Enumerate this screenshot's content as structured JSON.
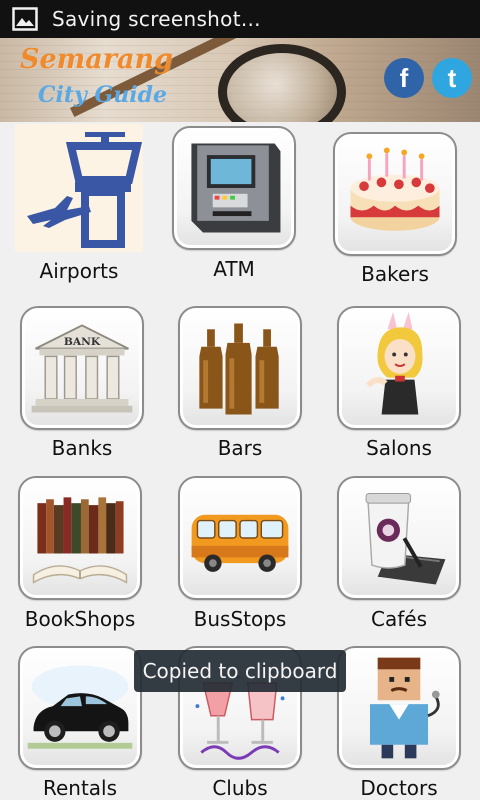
{
  "status_bar": {
    "text": "Saving screenshot...",
    "icon": "image-icon"
  },
  "banner": {
    "logo_line1": "Semarang",
    "logo_line2": "City Guide",
    "facebook_letter": "f",
    "twitter_letter": "t"
  },
  "categories": [
    {
      "label": "Airports",
      "icon": "airport-tower-icon"
    },
    {
      "label": "ATM",
      "icon": "atm-machine-icon"
    },
    {
      "label": "Bakers",
      "icon": "cake-icon"
    },
    {
      "label": "Banks",
      "icon": "bank-building-icon"
    },
    {
      "label": "Bars",
      "icon": "beer-bottles-icon"
    },
    {
      "label": "Salons",
      "icon": "salon-girl-icon"
    },
    {
      "label": "BookShops",
      "icon": "books-icon"
    },
    {
      "label": "BusStops",
      "icon": "bus-icon"
    },
    {
      "label": "Cafés",
      "icon": "coffee-cup-icon"
    },
    {
      "label": "Rentals",
      "icon": "car-icon"
    },
    {
      "label": "Clubs",
      "icon": "drinks-party-icon"
    },
    {
      "label": "Doctors",
      "icon": "doctor-icon"
    }
  ],
  "toast": {
    "text": "Copied to clipboard"
  },
  "colors": {
    "status_bar": "#111111",
    "facebook": "#2f64a8",
    "twitter": "#2fa6e0",
    "airport_icon": "#3a57a6"
  }
}
